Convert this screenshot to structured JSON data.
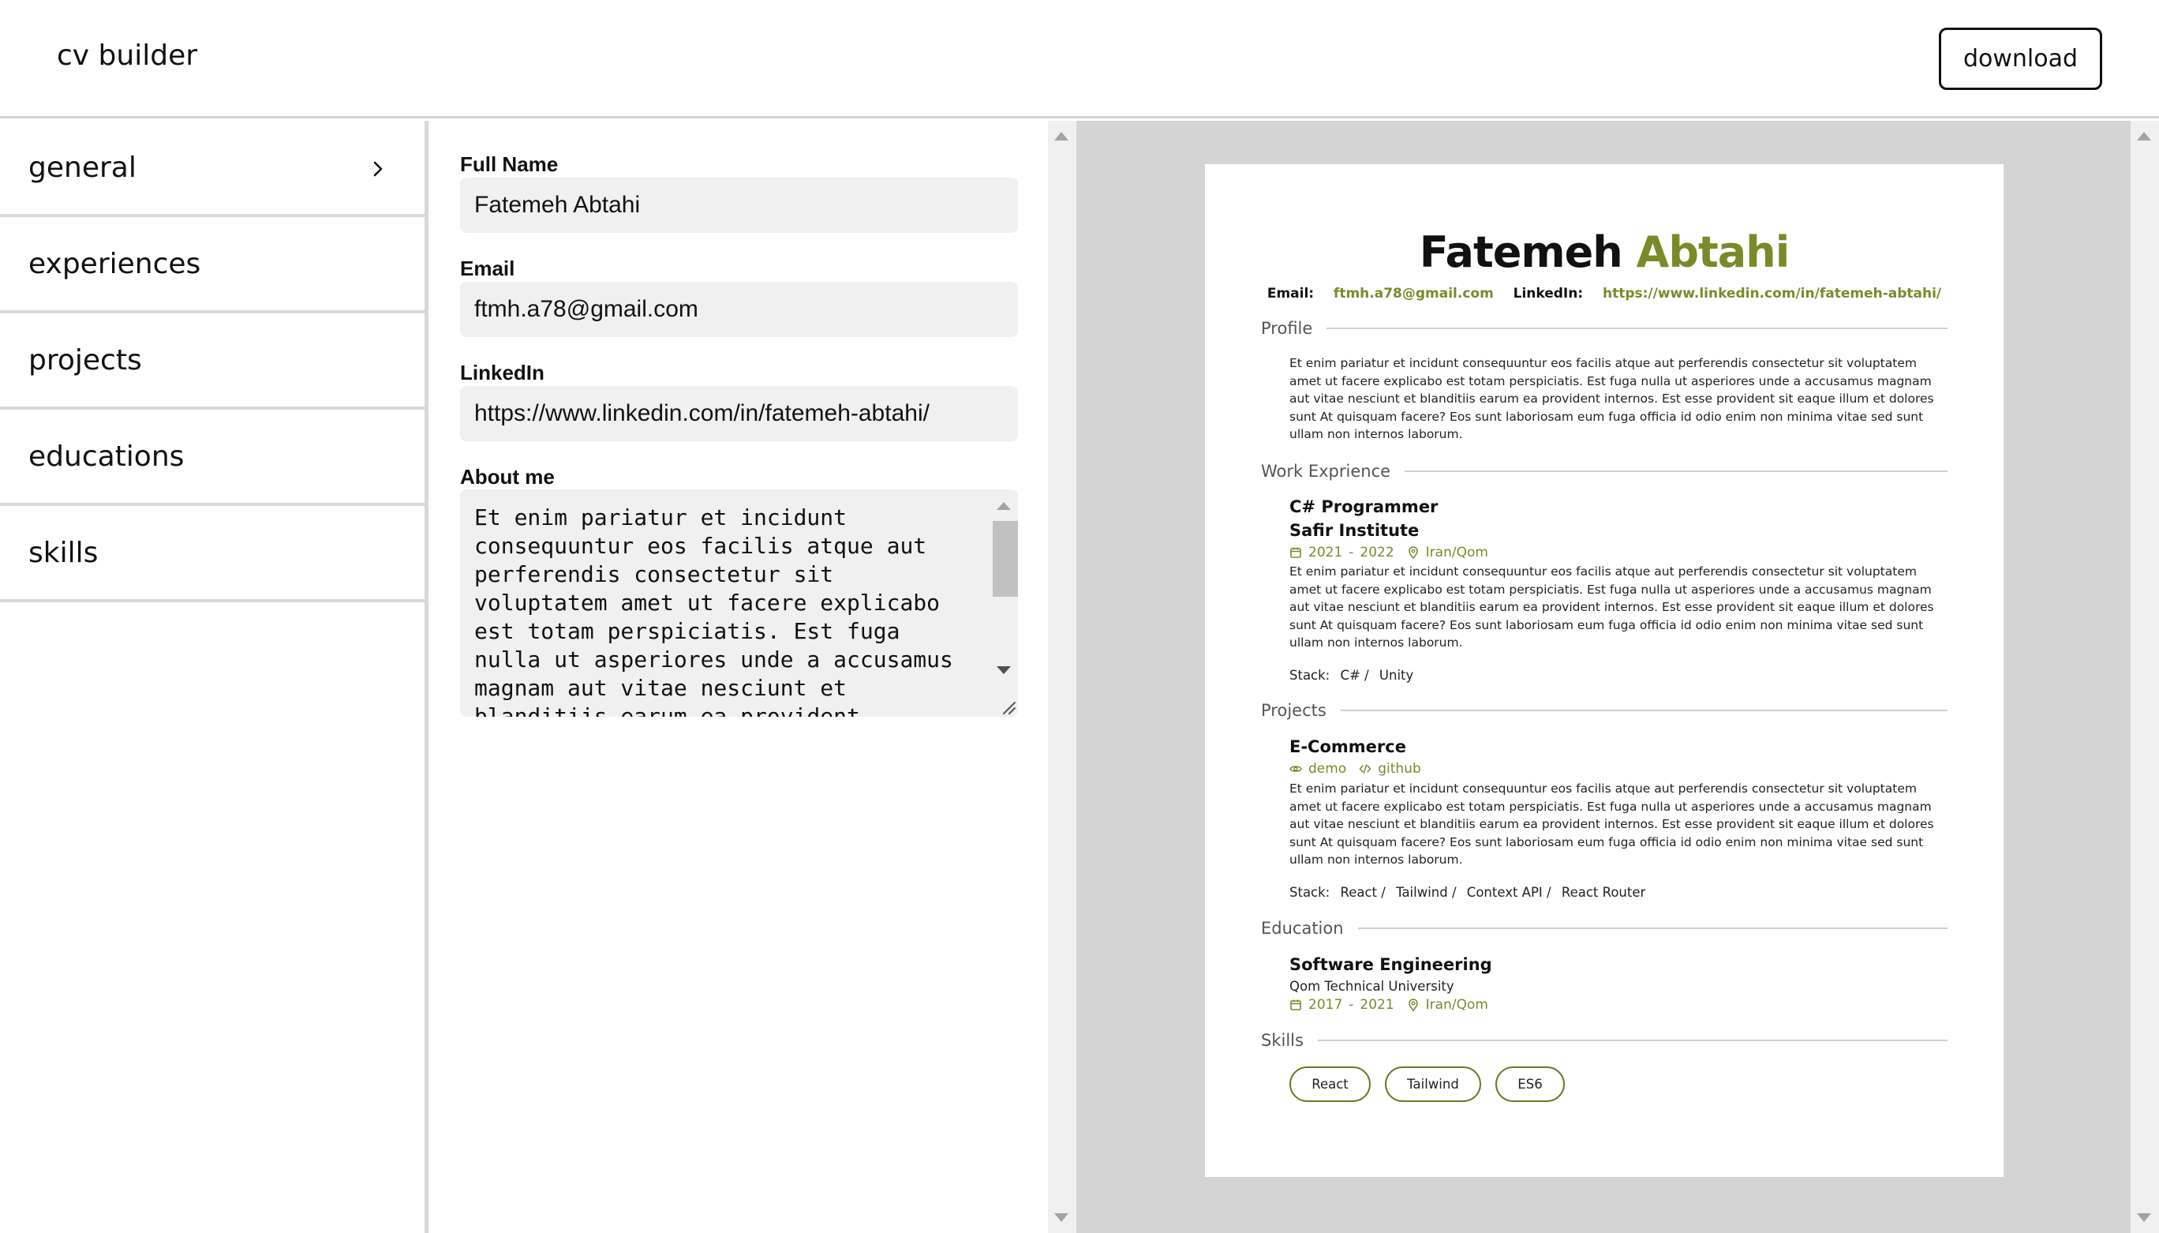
{
  "app": {
    "title": "cv builder",
    "download_label": "download"
  },
  "sidebar": {
    "items": [
      {
        "label": "general",
        "active": true
      },
      {
        "label": "experiences"
      },
      {
        "label": "projects"
      },
      {
        "label": "educations"
      },
      {
        "label": "skills"
      }
    ]
  },
  "form": {
    "full_name": {
      "label": "Full Name",
      "value": "Fatemeh Abtahi"
    },
    "email": {
      "label": "Email",
      "value": "ftmh.a78@gmail.com"
    },
    "linkedin": {
      "label": "LinkedIn",
      "value": "https://www.linkedin.com/in/fatemeh-abtahi/"
    },
    "about": {
      "label": "About me",
      "value": "Et enim pariatur et incidunt consequuntur eos facilis atque aut perferendis consectetur sit voluptatem amet ut facere explicabo est totam perspiciatis. Est fuga nulla ut asperiores unde a accusamus magnam aut vitae nesciunt et blanditiis earum ea provident internos. Est esse provident"
    }
  },
  "preview": {
    "first_name": "Fatemeh",
    "last_name": "Abtahi",
    "email_label": "Email:",
    "email": "ftmh.a78@gmail.com",
    "linkedin_label": "LinkedIn:",
    "linkedin": "https://www.linkedin.com/in/fatemeh-abtahi/",
    "profile_heading": "Profile",
    "profile_text": "Et enim pariatur et incidunt consequuntur eos facilis atque aut perferendis consectetur sit voluptatem amet ut facere explicabo est totam perspiciatis. Est fuga nulla ut asperiores unde a accusamus magnam aut vitae nesciunt et blanditiis earum ea provident internos. Est esse provident sit eaque illum et dolores sunt At quisquam facere? Eos sunt laboriosam eum fuga officia id odio enim non minima vitae sed sunt ullam non internos laborum.",
    "work_heading": "Work Exprience",
    "work": {
      "title": "C# Programmer",
      "company": "Safir Institute",
      "start": "2021",
      "dash": "-",
      "end": "2022",
      "location": "Iran/Qom",
      "description": "Et enim pariatur et incidunt consequuntur eos facilis atque aut perferendis consectetur sit voluptatem amet ut facere explicabo est totam perspiciatis. Est fuga nulla ut asperiores unde a accusamus magnam aut vitae nesciunt et blanditiis earum ea provident internos. Est esse provident sit eaque illum et dolores sunt At quisquam facere? Eos sunt laboriosam eum fuga officia id odio enim non minima vitae sed sunt ullam non internos laborum.",
      "stack_label": "Stack:",
      "stack": [
        "C# /",
        "Unity"
      ]
    },
    "projects_heading": "Projects",
    "project": {
      "title": "E-Commerce",
      "demo": "demo",
      "github": "github",
      "description": "Et enim pariatur et incidunt consequuntur eos facilis atque aut perferendis consectetur sit voluptatem amet ut facere explicabo est totam perspiciatis. Est fuga nulla ut asperiores unde a accusamus magnam aut vitae nesciunt et blanditiis earum ea provident internos. Est esse provident sit eaque illum et dolores sunt At quisquam facere? Eos sunt laboriosam eum fuga officia id odio enim non minima vitae sed sunt ullam non internos laborum.",
      "stack_label": "Stack:",
      "stack": [
        "React /",
        "Tailwind /",
        "Context API /",
        "React Router"
      ]
    },
    "education_heading": "Education",
    "education": {
      "degree": "Software Engineering",
      "school": "Qom Technical University",
      "start": "2017",
      "dash": "-",
      "end": "2021",
      "location": "Iran/Qom"
    },
    "skills_heading": "Skills",
    "skills": [
      "React",
      "Tailwind",
      "ES6"
    ],
    "accent_color": "#7a8a2a"
  }
}
